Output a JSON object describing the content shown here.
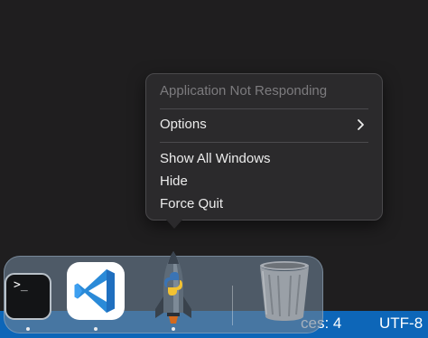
{
  "context_menu": {
    "header": "Application Not Responding",
    "items": [
      {
        "label": "Options",
        "has_submenu": true,
        "submenu_icon": "chevron-right-icon"
      },
      {
        "label": "Show All Windows"
      },
      {
        "label": "Hide"
      },
      {
        "label": "Force Quit"
      }
    ]
  },
  "status_bar": {
    "spaces": "ces: 4",
    "encoding": "UTF-8",
    "color": "#0d66b8"
  },
  "dock": {
    "apps": [
      {
        "icon": "terminal-icon",
        "prompt": ">_",
        "running": true
      },
      {
        "icon": "vscode-icon",
        "running": true
      },
      {
        "icon": "python-launcher-rocket-icon",
        "running": true
      },
      {
        "icon": "trash-icon",
        "running": false
      }
    ]
  }
}
